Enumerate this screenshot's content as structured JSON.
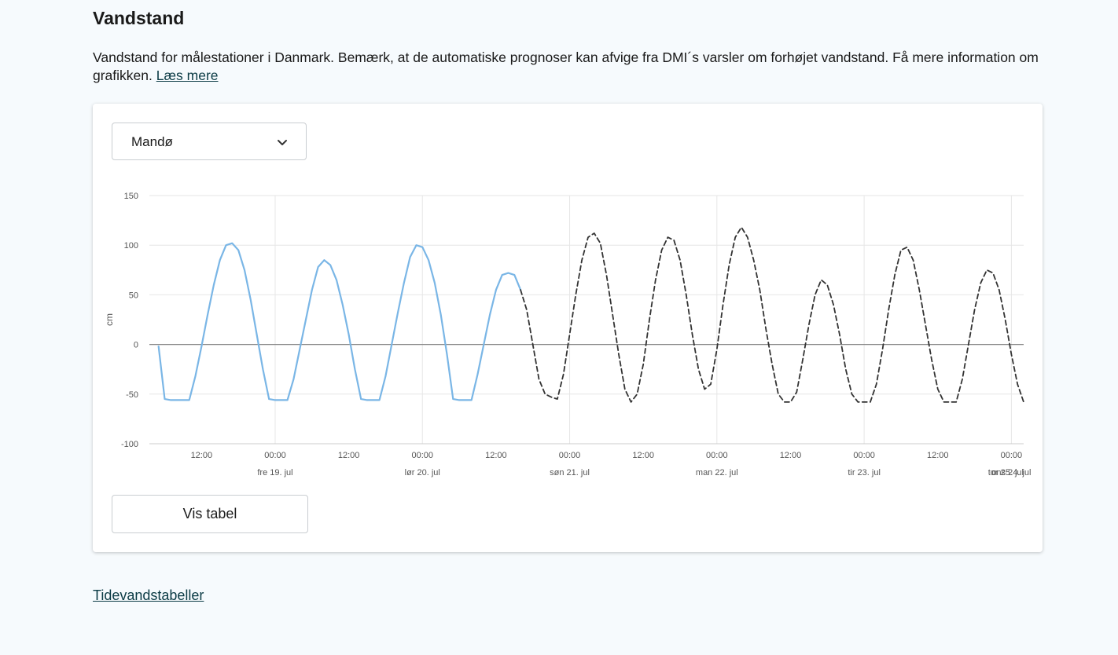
{
  "page": {
    "title": "Vandstand",
    "intro_text": "Vandstand for målestationer i Danmark. Bemærk, at de automatiske prognoser kan afvige fra DMI´s varsler om forhøjet vandstand. Få mere information om grafikken. ",
    "intro_link": "Læs mere",
    "footer_link": "Tidevandstabeller"
  },
  "station_select": {
    "selected": "Mandø",
    "icon": "chevron-down-icon"
  },
  "table_button": {
    "label": "Vis tabel"
  },
  "colors": {
    "observed": "#7ab6e6",
    "forecast": "#333333",
    "zero_line": "#8a8a8a",
    "grid": "#e6e6e6",
    "link": "#0b3b45"
  },
  "chart_data": {
    "type": "line",
    "ylabel": "cm",
    "ylim": [
      -100,
      150
    ],
    "yticks": [
      150,
      100,
      50,
      0,
      -50,
      -100
    ],
    "xlim": [
      3.5,
      146
    ],
    "time_labels": [
      {
        "x": 12,
        "label": "12:00"
      },
      {
        "x": 24,
        "label": "00:00"
      },
      {
        "x": 36,
        "label": "12:00"
      },
      {
        "x": 48,
        "label": "00:00"
      },
      {
        "x": 60,
        "label": "12:00"
      },
      {
        "x": 72,
        "label": "00:00"
      },
      {
        "x": 84,
        "label": "12:00"
      },
      {
        "x": 96,
        "label": "00:00"
      },
      {
        "x": 108,
        "label": "12:00"
      },
      {
        "x": 120,
        "label": "00:00"
      },
      {
        "x": 132,
        "label": "12:00"
      },
      {
        "x": 144,
        "label": "00:00"
      }
    ],
    "day_labels": [
      {
        "x": 24,
        "label": "fre 19. jul"
      },
      {
        "x": 48,
        "label": "lør 20. jul"
      },
      {
        "x": 72,
        "label": "søn 21. jul"
      },
      {
        "x": 96,
        "label": "man 22. jul"
      },
      {
        "x": 120,
        "label": "tir 23. jul"
      },
      {
        "x": 144,
        "label": "ons 24. jul"
      },
      {
        "x": 146,
        "label": "tor 25. jul"
      }
    ],
    "series": [
      {
        "style": "observed",
        "points": [
          [
            5,
            -2
          ],
          [
            6,
            -55
          ],
          [
            7,
            -56
          ],
          [
            8,
            -56
          ],
          [
            9,
            -56
          ],
          [
            10,
            -56
          ],
          [
            11,
            -32
          ],
          [
            12,
            -2
          ],
          [
            13,
            30
          ],
          [
            14,
            60
          ],
          [
            15,
            85
          ],
          [
            16,
            100
          ],
          [
            17,
            102
          ],
          [
            18,
            95
          ],
          [
            19,
            75
          ],
          [
            20,
            45
          ],
          [
            21,
            10
          ],
          [
            22,
            -25
          ],
          [
            23,
            -55
          ],
          [
            24,
            -56
          ],
          [
            25,
            -56
          ],
          [
            26,
            -56
          ],
          [
            27,
            -35
          ],
          [
            28,
            -5
          ],
          [
            29,
            25
          ],
          [
            30,
            55
          ],
          [
            31,
            78
          ],
          [
            32,
            85
          ],
          [
            33,
            80
          ],
          [
            34,
            65
          ],
          [
            35,
            40
          ],
          [
            36,
            10
          ],
          [
            37,
            -25
          ],
          [
            38,
            -55
          ],
          [
            39,
            -56
          ],
          [
            40,
            -56
          ],
          [
            41,
            -56
          ],
          [
            42,
            -32
          ],
          [
            43,
            0
          ],
          [
            44,
            32
          ],
          [
            45,
            62
          ],
          [
            46,
            88
          ],
          [
            47,
            100
          ],
          [
            48,
            98
          ],
          [
            49,
            85
          ],
          [
            50,
            62
          ],
          [
            51,
            30
          ],
          [
            52,
            -10
          ],
          [
            53,
            -55
          ],
          [
            54,
            -56
          ],
          [
            55,
            -56
          ],
          [
            56,
            -56
          ],
          [
            57,
            -30
          ],
          [
            58,
            0
          ],
          [
            59,
            30
          ],
          [
            60,
            55
          ],
          [
            61,
            70
          ],
          [
            62,
            72
          ],
          [
            63,
            70
          ],
          [
            64,
            55
          ]
        ]
      },
      {
        "style": "forecast",
        "points": [
          [
            64,
            55
          ],
          [
            65,
            35
          ],
          [
            66,
            0
          ],
          [
            67,
            -35
          ],
          [
            68,
            -50
          ],
          [
            69,
            -53
          ],
          [
            70,
            -55
          ],
          [
            71,
            -30
          ],
          [
            72,
            10
          ],
          [
            73,
            50
          ],
          [
            74,
            85
          ],
          [
            75,
            108
          ],
          [
            76,
            112
          ],
          [
            77,
            102
          ],
          [
            78,
            70
          ],
          [
            79,
            30
          ],
          [
            80,
            -10
          ],
          [
            81,
            -45
          ],
          [
            82,
            -58
          ],
          [
            83,
            -50
          ],
          [
            84,
            -20
          ],
          [
            85,
            25
          ],
          [
            86,
            65
          ],
          [
            87,
            95
          ],
          [
            88,
            108
          ],
          [
            89,
            105
          ],
          [
            90,
            85
          ],
          [
            91,
            50
          ],
          [
            92,
            10
          ],
          [
            93,
            -25
          ],
          [
            94,
            -45
          ],
          [
            95,
            -40
          ],
          [
            96,
            -5
          ],
          [
            97,
            40
          ],
          [
            98,
            80
          ],
          [
            99,
            108
          ],
          [
            100,
            118
          ],
          [
            101,
            108
          ],
          [
            102,
            85
          ],
          [
            103,
            55
          ],
          [
            104,
            15
          ],
          [
            105,
            -20
          ],
          [
            106,
            -50
          ],
          [
            107,
            -58
          ],
          [
            108,
            -58
          ],
          [
            109,
            -48
          ],
          [
            110,
            -15
          ],
          [
            111,
            20
          ],
          [
            112,
            50
          ],
          [
            113,
            65
          ],
          [
            114,
            60
          ],
          [
            115,
            40
          ],
          [
            116,
            10
          ],
          [
            117,
            -25
          ],
          [
            118,
            -50
          ],
          [
            119,
            -58
          ],
          [
            120,
            -58
          ],
          [
            121,
            -58
          ],
          [
            122,
            -40
          ],
          [
            123,
            -5
          ],
          [
            124,
            35
          ],
          [
            125,
            70
          ],
          [
            126,
            95
          ],
          [
            127,
            98
          ],
          [
            128,
            85
          ],
          [
            129,
            55
          ],
          [
            130,
            20
          ],
          [
            131,
            -15
          ],
          [
            132,
            -45
          ],
          [
            133,
            -58
          ],
          [
            134,
            -58
          ],
          [
            135,
            -58
          ],
          [
            136,
            -35
          ],
          [
            137,
            0
          ],
          [
            138,
            35
          ],
          [
            139,
            62
          ],
          [
            140,
            75
          ],
          [
            141,
            72
          ],
          [
            142,
            55
          ],
          [
            143,
            25
          ],
          [
            144,
            -10
          ],
          [
            145,
            -40
          ],
          [
            146,
            -58
          ]
        ]
      }
    ]
  }
}
